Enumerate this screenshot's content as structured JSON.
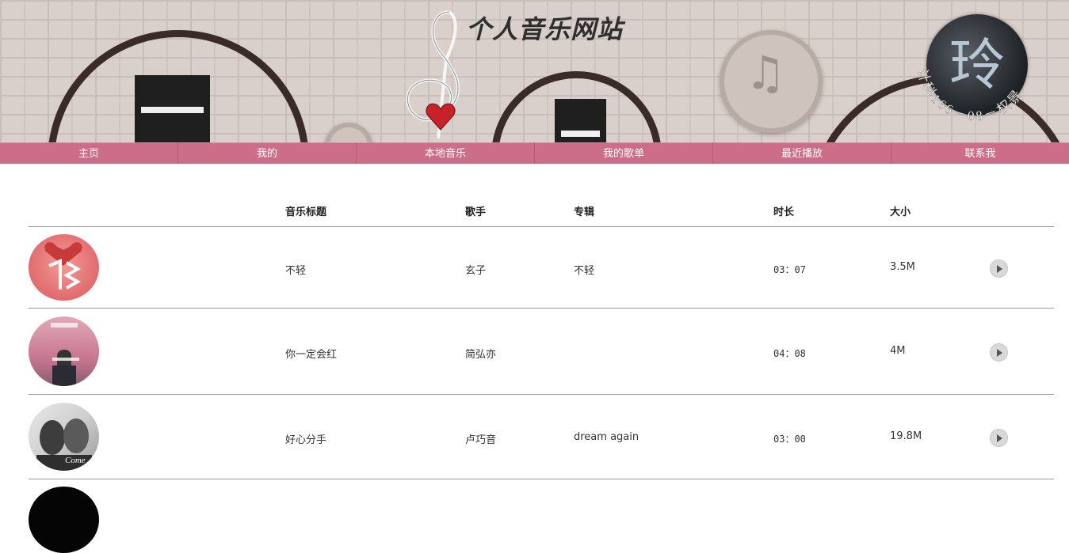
{
  "header": {
    "title": "个人音乐网站",
    "badge_glyph": "玲",
    "badge_arc_text": "计科166－08－权景"
  },
  "nav": {
    "items": [
      "主页",
      "我的",
      "本地音乐",
      "我的歌单",
      "最近播放",
      "联系我"
    ]
  },
  "table": {
    "columns": [
      "音乐标题",
      "歌手",
      "专辑",
      "时长",
      "大小"
    ],
    "rows": [
      {
        "title": "不轻",
        "artist": "玄子",
        "album": "不轻",
        "duration": "03：07",
        "size": "3.5M"
      },
      {
        "title": "你一定会红",
        "artist": "简弘亦",
        "album": "",
        "duration": "04：08",
        "size": "4M"
      },
      {
        "title": "好心分手",
        "artist": "卢巧音",
        "album": "dream again",
        "duration": "03：00",
        "size": "19.8M"
      }
    ]
  },
  "colors": {
    "nav_bg": "#cc6e88",
    "banner_bg": "#d9cfcb"
  }
}
